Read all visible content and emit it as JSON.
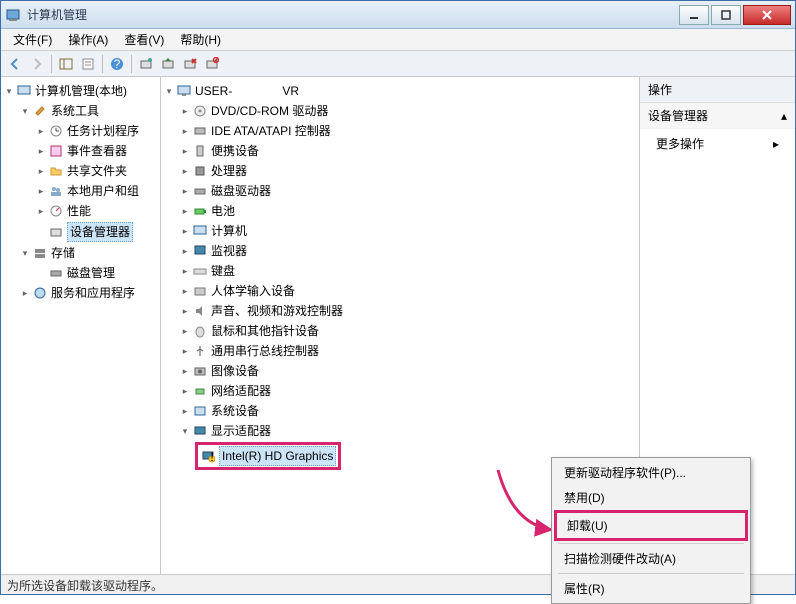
{
  "window": {
    "title": "计算机管理"
  },
  "menu": {
    "file": "文件(F)",
    "action": "操作(A)",
    "view": "查看(V)",
    "help": "帮助(H)"
  },
  "left": {
    "root": "计算机管理(本地)",
    "systools": "系统工具",
    "tasksched": "任务计划程序",
    "eventviewer": "事件查看器",
    "shared": "共享文件夹",
    "users": "本地用户和组",
    "perf": "性能",
    "devmgr": "设备管理器",
    "storage": "存储",
    "diskmgmt": "磁盘管理",
    "services": "服务和应用程序"
  },
  "mid": {
    "root_prefix": "USER-",
    "root_suffix": "VR",
    "dvd": "DVD/CD-ROM 驱动器",
    "ide": "IDE ATA/ATAPI 控制器",
    "portable": "便携设备",
    "cpu": "处理器",
    "diskdrive": "磁盘驱动器",
    "battery": "电池",
    "computer": "计算机",
    "monitor": "监视器",
    "keyboard": "键盘",
    "hid": "人体学输入设备",
    "sound": "声音、视频和游戏控制器",
    "mouse": "鼠标和其他指针设备",
    "usb": "通用串行总线控制器",
    "imaging": "图像设备",
    "net": "网络适配器",
    "sysdev": "系统设备",
    "display": "显示适配器",
    "gpu": "Intel(R) HD Graphics"
  },
  "context": {
    "update": "更新驱动程序软件(P)...",
    "disable": "禁用(D)",
    "uninstall": "卸载(U)",
    "scan": "扫描检测硬件改动(A)",
    "props": "属性(R)"
  },
  "right": {
    "header": "操作",
    "sub": "设备管理器",
    "more": "更多操作"
  },
  "status": "为所选设备卸载该驱动程序。"
}
